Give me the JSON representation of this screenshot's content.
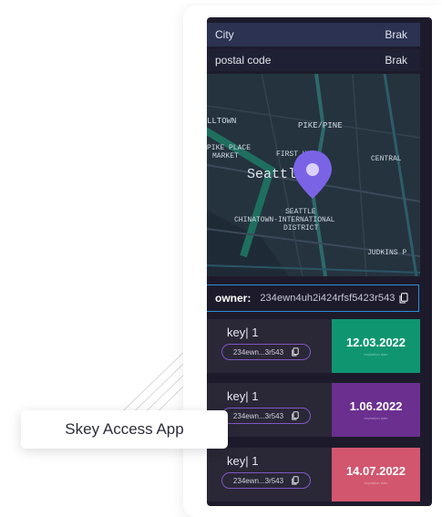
{
  "info": {
    "city_label": "City",
    "city_value": "Brak",
    "postal_label": "postal code",
    "postal_value": "Brak"
  },
  "map": {
    "labels": [
      "LLTOWN",
      "PIKE/PINE",
      "PIKE PLACE",
      "MARKET",
      "FIRST HILL",
      "Seattle",
      "CENTRAL",
      "SEATTLE",
      "CHINATOWN-INTERNATIONAL",
      "DISTRICT",
      "JUDKINS P"
    ],
    "pin_icon": "location-pin-icon",
    "pin_color": "#7b63e6"
  },
  "owner": {
    "label": "owner:",
    "value": "234ewn4uh2i424rfsf5423r543",
    "border_color": "#2d8fd8"
  },
  "keys": [
    {
      "title": "key| 1",
      "code": "234ewn...3r543",
      "date": "12.03.2022",
      "caption": "expiration date",
      "color": "#0f9670"
    },
    {
      "title": "key| 1",
      "code": "234ewn...3r543",
      "date": "1.06.2022",
      "caption": "expiration date",
      "color": "#6a2f8f"
    },
    {
      "title": "key| 1",
      "code": "234ewn...3r543",
      "date": "14.07.2022",
      "caption": "expiration date",
      "color": "#d2566e"
    }
  ],
  "app_label": "Skey Access App"
}
